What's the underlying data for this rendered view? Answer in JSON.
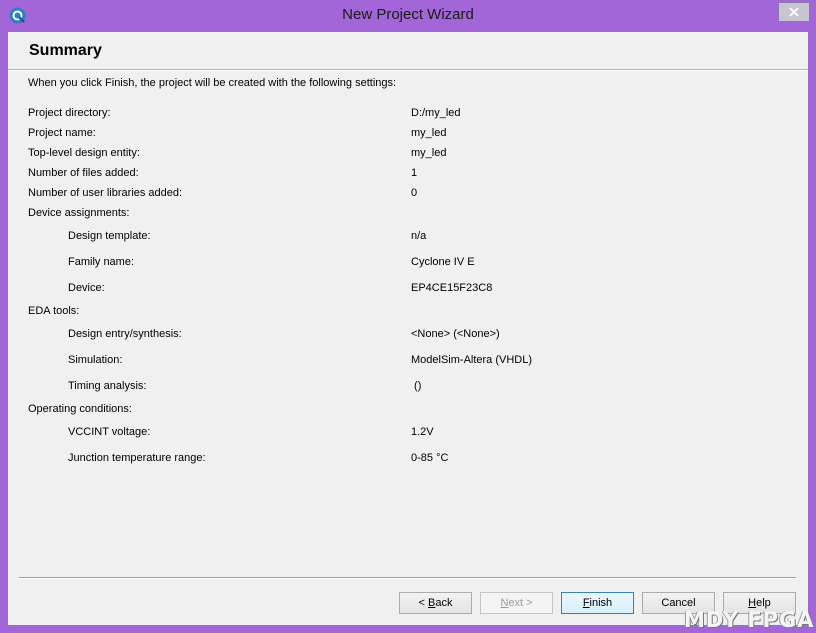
{
  "window": {
    "title": "New Project Wizard"
  },
  "summary": {
    "heading": "Summary",
    "intro": "When you click Finish, the project will be created with the following settings:",
    "rows": [
      {
        "label": "Project directory:",
        "value": "D:/my_led"
      },
      {
        "label": "Project name:",
        "value": "my_led"
      },
      {
        "label": "Top-level design entity:",
        "value": "my_led"
      },
      {
        "label": "Number of files added:",
        "value": "1"
      },
      {
        "label": "Number of user libraries added:",
        "value": "0"
      },
      {
        "label": "Device assignments:",
        "value": ""
      },
      {
        "label": "Design template:",
        "value": "n/a"
      },
      {
        "label": "Family name:",
        "value": "Cyclone IV E"
      },
      {
        "label": "Device:",
        "value": "EP4CE15F23C8"
      },
      {
        "label": "EDA tools:",
        "value": ""
      },
      {
        "label": "Design entry/synthesis:",
        "value": "<None> (<None>)"
      },
      {
        "label": "Simulation:",
        "value": "ModelSim-Altera (VHDL)"
      },
      {
        "label": "Timing analysis:",
        "value": " ()"
      },
      {
        "label": "Operating conditions:",
        "value": ""
      },
      {
        "label": "VCCINT voltage:",
        "value": "1.2V"
      },
      {
        "label": "Junction temperature range:",
        "value": "0-85 °C"
      }
    ]
  },
  "buttons": {
    "back": {
      "mnemonic": "B",
      "rest": "ack",
      "prefix": "< "
    },
    "next": {
      "mnemonic": "N",
      "rest": "ext >"
    },
    "finish": {
      "mnemonic": "F",
      "rest": "inish"
    },
    "cancel": "Cancel",
    "help": {
      "mnemonic": "H",
      "rest": "elp"
    }
  },
  "watermark": "MDY FPGA",
  "icons": {
    "app": "quartus-app-icon",
    "close": "close-icon"
  }
}
